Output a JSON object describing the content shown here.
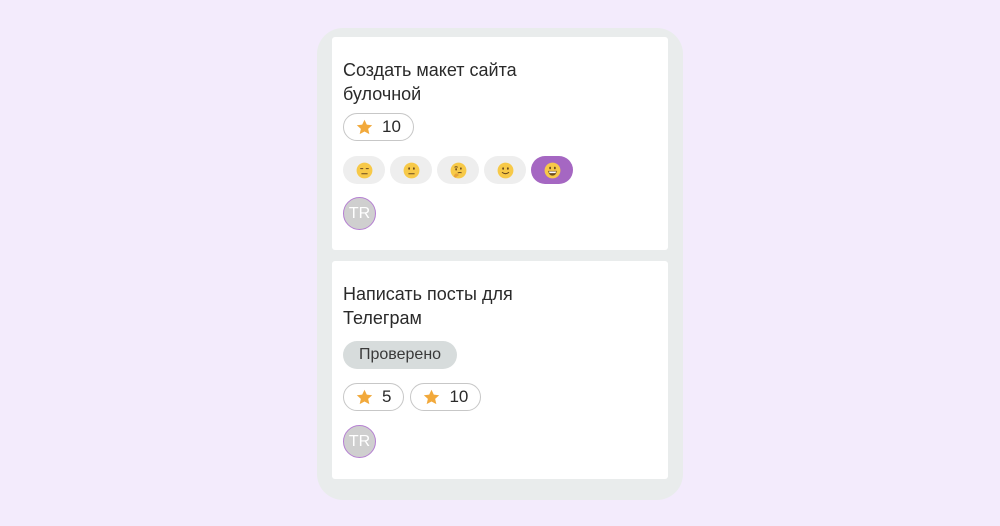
{
  "board": {
    "cards": [
      {
        "title": "Создать макет сайта\nбулочной",
        "ratings": [
          {
            "icon": "star-icon",
            "value": "10"
          }
        ],
        "reactions": [
          {
            "icon": "expressionless-face-icon",
            "active": false
          },
          {
            "icon": "neutral-face-icon",
            "active": false
          },
          {
            "icon": "thinking-face-icon",
            "active": false
          },
          {
            "icon": "slightly-smiling-face-icon",
            "active": false
          },
          {
            "icon": "grinning-face-icon",
            "active": true
          }
        ],
        "assignee_initials": "TR"
      },
      {
        "title": "Написать посты для\nТелеграм",
        "status": "Проверено",
        "ratings": [
          {
            "icon": "star-icon",
            "value": "5"
          },
          {
            "icon": "star-icon",
            "value": "10"
          }
        ],
        "assignee_initials": "TR"
      }
    ]
  },
  "colors": {
    "background": "#f3ebfc",
    "column": "#e9ecec",
    "accent": "#a567c2",
    "star": "#f2a93b"
  }
}
